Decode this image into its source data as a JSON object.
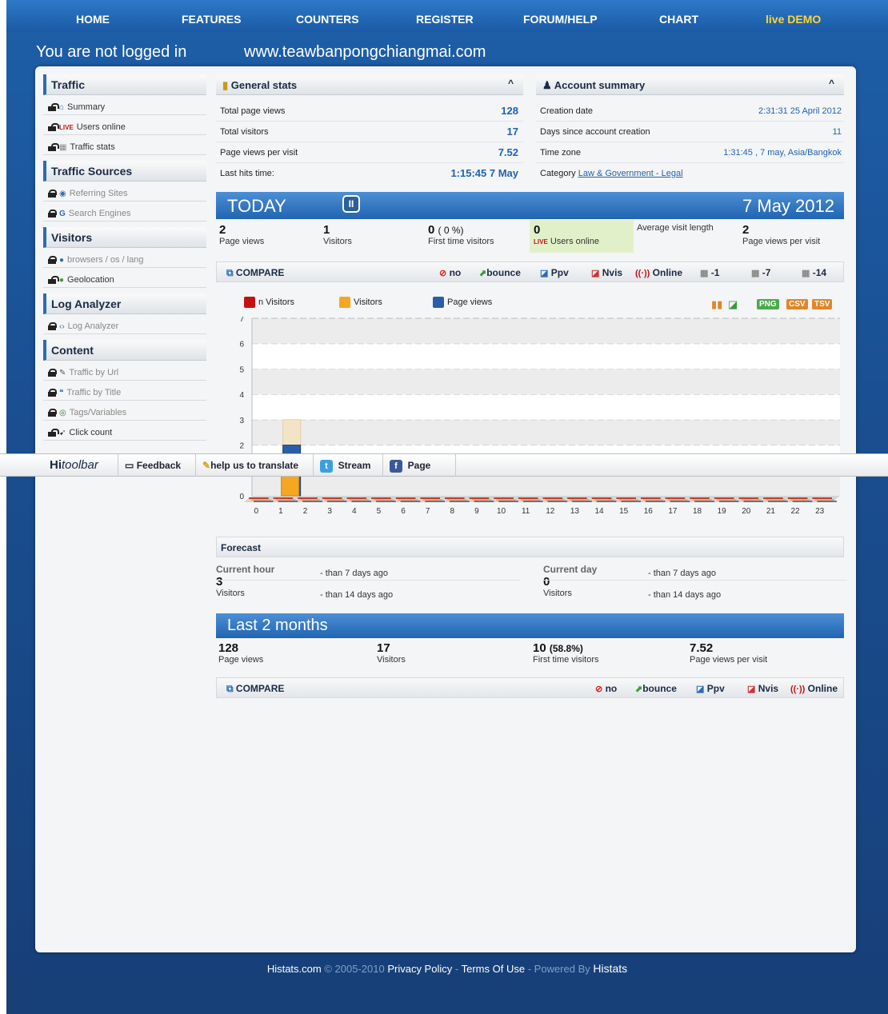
{
  "nav": {
    "items": [
      "HOME",
      "FEATURES",
      "COUNTERS",
      "REGISTER",
      "FORUM/HELP",
      "CHART",
      "live DEMO"
    ]
  },
  "header": {
    "login_status": "You are not logged in",
    "site_url": "www.teawbanpongchiangmai.com"
  },
  "sidebar": {
    "sections": [
      {
        "title": "Traffic",
        "items": [
          {
            "label": "Summary",
            "icon": "home-icon",
            "locked": false
          },
          {
            "label": "Users online",
            "icon": "live-icon",
            "locked": false
          },
          {
            "label": "Traffic stats",
            "icon": "calendar-icon",
            "locked": false
          }
        ]
      },
      {
        "title": "Traffic Sources",
        "items": [
          {
            "label": "Referring Sites",
            "icon": "referring-icon",
            "locked": true
          },
          {
            "label": "Search Engines",
            "icon": "google-icon",
            "locked": true
          }
        ]
      },
      {
        "title": "Visitors",
        "items": [
          {
            "label": "browsers / os / lang",
            "icon": "browser-icon",
            "locked": true
          },
          {
            "label": "Geolocation",
            "icon": "globe-icon",
            "locked": false
          }
        ]
      },
      {
        "title": "Log Analyzer",
        "items": [
          {
            "label": "Log Analyzer",
            "icon": "code-icon",
            "locked": true
          }
        ]
      },
      {
        "title": "Content",
        "items": [
          {
            "label": "Traffic by Url",
            "icon": "link-icon",
            "locked": true
          },
          {
            "label": "Traffic by Title",
            "icon": "quote-icon",
            "locked": true
          },
          {
            "label": "Tags/Variables",
            "icon": "tag-icon",
            "locked": true
          },
          {
            "label": "Click count",
            "icon": "cursor-icon",
            "locked": false
          }
        ]
      }
    ]
  },
  "general_stats": {
    "title": "General stats",
    "rows": [
      {
        "label": "Total page views",
        "value": "128"
      },
      {
        "label": "Total visitors",
        "value": "17"
      },
      {
        "label": "Page views per visit",
        "value": "7.52"
      },
      {
        "label": "Last hits time:",
        "value": "1:15:45 7 May"
      }
    ]
  },
  "account_summary": {
    "title": "Account summary",
    "creation_label": "Creation date",
    "creation_value": "2:31:31 25 April 2012",
    "days_label": "Days since account creation",
    "days_value": "11",
    "tz_label": "Time zone",
    "tz_value": "1:31:45 , 7 may, Asia/Bangkok",
    "category_label": "Category",
    "category_value": "Law & Government - Legal"
  },
  "today": {
    "title": "TODAY",
    "date": "7 May 2012",
    "pause": "II",
    "metrics": [
      {
        "value": "2",
        "label": "Page views"
      },
      {
        "value": "1",
        "label": "Visitors"
      },
      {
        "value": "0",
        "extra": "( 0 %)",
        "label": "First time visitors"
      },
      {
        "value": "0",
        "label": "Users online"
      },
      {
        "value": "",
        "label": "Average visit length"
      },
      {
        "value": "2",
        "label": "Page views per visit"
      }
    ]
  },
  "compare": {
    "title": "COMPARE",
    "buttons": [
      "no",
      "bounce",
      "Ppv",
      "Nvis",
      "Online",
      "-1",
      "-7",
      "-14"
    ]
  },
  "legend": {
    "items": [
      {
        "label": "n Visitors",
        "color": "#c41212"
      },
      {
        "label": "Visitors",
        "color": "#f5a623"
      },
      {
        "label": "Page views",
        "color": "#2a5ea8"
      }
    ],
    "exports": [
      "PNG",
      "CSV",
      "TSV"
    ]
  },
  "chart_data": {
    "type": "bar",
    "categories": [
      "0",
      "1",
      "2",
      "3",
      "4",
      "5",
      "6",
      "7",
      "8",
      "9",
      "10",
      "11",
      "12",
      "13",
      "14",
      "15",
      "16",
      "17",
      "18",
      "19",
      "20",
      "21",
      "22",
      "23"
    ],
    "series": [
      {
        "name": "n Visitors",
        "values": [
          0,
          0,
          0,
          0,
          0,
          0,
          0,
          0,
          0,
          0,
          0,
          0,
          0,
          0,
          0,
          0,
          0,
          0,
          0,
          0,
          0,
          0,
          0,
          0
        ]
      },
      {
        "name": "Visitors",
        "values": [
          0,
          1,
          0,
          0,
          0,
          0,
          0,
          0,
          0,
          0,
          0,
          0,
          0,
          0,
          0,
          0,
          0,
          0,
          0,
          0,
          0,
          0,
          0,
          0
        ]
      },
      {
        "name": "Page views",
        "values": [
          0,
          2,
          0,
          0,
          0,
          0,
          0,
          0,
          0,
          0,
          0,
          0,
          0,
          0,
          0,
          0,
          0,
          0,
          0,
          0,
          0,
          0,
          0,
          0
        ]
      }
    ],
    "overlay_previous": {
      "values": [
        0,
        3,
        0,
        0,
        0,
        0,
        0,
        0,
        0,
        0,
        0,
        0,
        0,
        0,
        0,
        0,
        0,
        0,
        0,
        0,
        0,
        0,
        0,
        0
      ]
    },
    "yticks": [
      "0",
      "1",
      "2",
      "3",
      "4",
      "5",
      "6",
      "7"
    ],
    "ylim": [
      0,
      7
    ]
  },
  "toolbar": {
    "brand_bold": "Hi",
    "brand_italic": "toolbar",
    "feedback": "Feedback",
    "translate": "help us to translate",
    "stream": "Stream",
    "page": "Page"
  },
  "forecast": {
    "title": "Forecast",
    "hour_label": "Current hour",
    "hour_value": "3",
    "hour_unit": "Visitors",
    "day_label": "Current day",
    "day_value": "0",
    "day_unit": "Visitors",
    "cmp7": "- than 7 days ago",
    "cmp14": "- than 14 days ago"
  },
  "last2": {
    "title": "Last 2 months",
    "metrics": [
      {
        "value": "128",
        "label": "Page views"
      },
      {
        "value": "17",
        "label": "Visitors"
      },
      {
        "value": "10",
        "extra": "(58.8%)",
        "label": "First time visitors"
      },
      {
        "value": "7.52",
        "label": "Page views per visit"
      }
    ]
  },
  "compare2": {
    "title": "COMPARE",
    "buttons": [
      "no",
      "bounce",
      "Ppv",
      "Nvis",
      "Online"
    ]
  },
  "footer": {
    "site": "Histats.com",
    "copyright": "© 2005-2010",
    "privacy": "Privacy Policy",
    "sep": "-",
    "terms": "Terms Of Use",
    "powered": "- Powered By",
    "brand": "Histats"
  }
}
